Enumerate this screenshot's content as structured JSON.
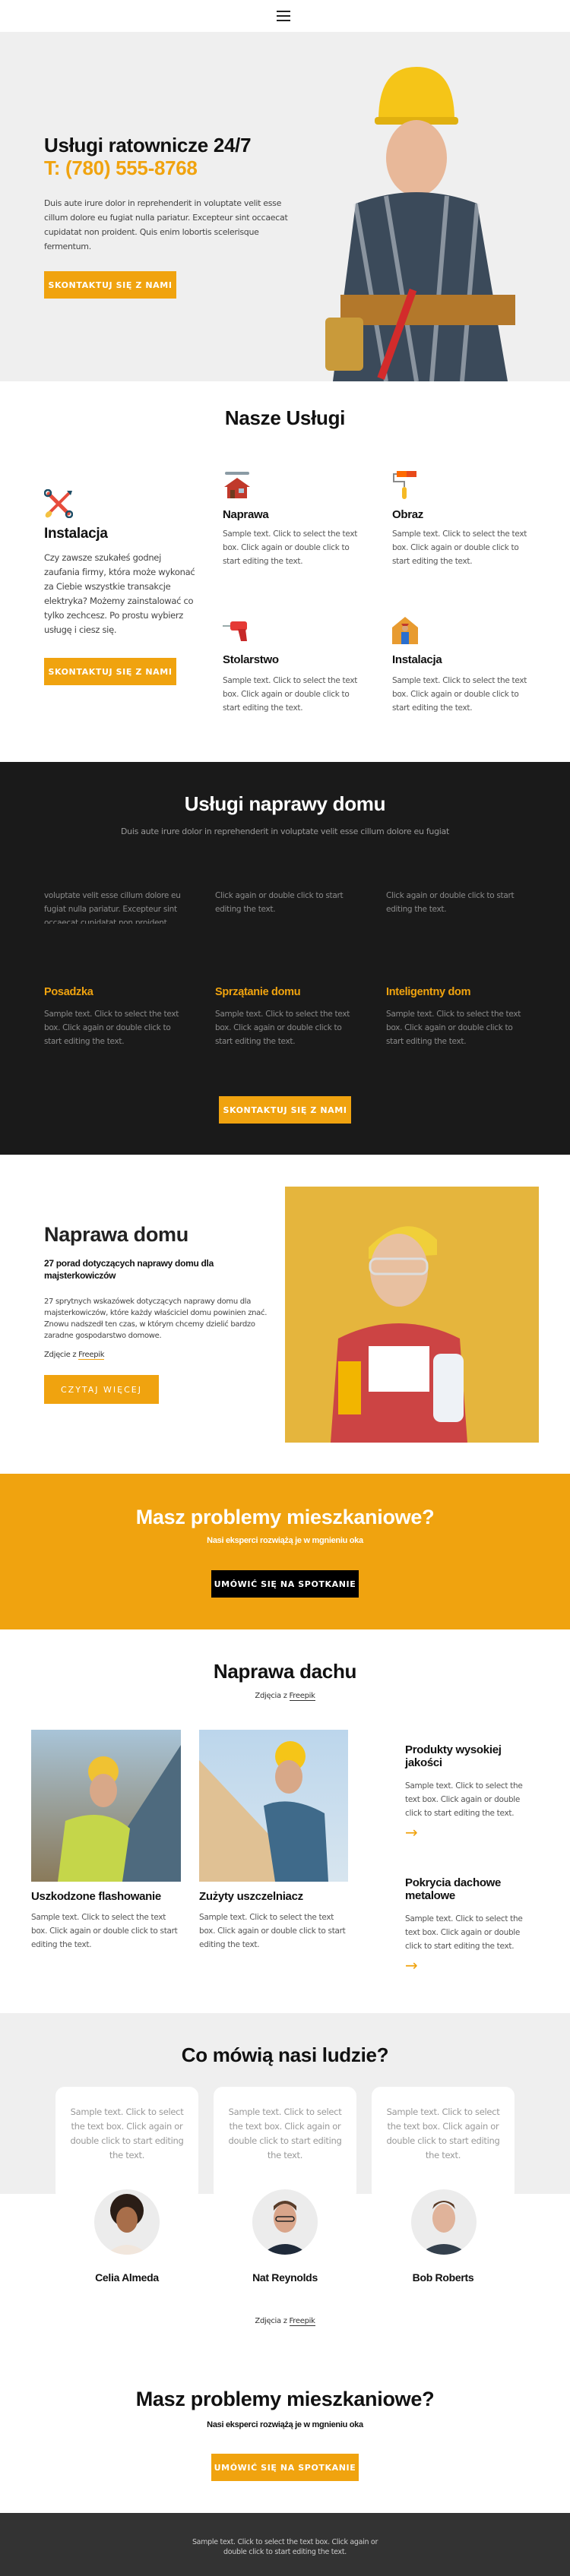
{
  "header": {
    "menu_icon": "hamburger-menu-icon"
  },
  "hero": {
    "title": "Usługi ratownicze 24/7",
    "phone": "T: (780) 555-8768",
    "text": "Duis aute irure dolor in reprehenderit in voluptate velit esse cillum dolore eu fugiat nulla pariatur. Excepteur sint occaecat cupidatat non proident. Quis enim lobortis scelerisque fermentum.",
    "button": "SKONTAKTUJ SIĘ Z NAMI",
    "image": "worker-with-hard-hat-photo"
  },
  "services": {
    "heading": "Nasze Usługi",
    "featured": {
      "icon": "tools-icon",
      "title": "Instalacja",
      "text": "Czy zawsze szukałeś godnej zaufania firmy, która może wykonać za Ciebie wszystkie transakcje elektryka? Możemy zainstalować co tylko zechcesz. Po prostu wybierz usługę i ciesz się.",
      "button": "SKONTAKTUJ SIĘ Z NAMI"
    },
    "items": [
      {
        "icon": "house-repair-icon",
        "title": "Naprawa",
        "text": "Sample text. Click to select the text box. Click again or double click to start editing the text."
      },
      {
        "icon": "paint-roller-icon",
        "title": "Obraz",
        "text": "Sample text. Click to select the text box. Click again or double click to start editing the text."
      },
      {
        "icon": "drill-icon",
        "title": "Stolarstwo",
        "text": "Sample text. Click to select the text box. Click again or double click to start editing the text."
      },
      {
        "icon": "house-worker-icon",
        "title": "Instalacja",
        "text": "Sample text. Click to select the text box. Click again or double click to start editing the text."
      }
    ]
  },
  "home_repair": {
    "heading": "Usługi naprawy domu",
    "subheading": "Duis aute irure dolor in reprehenderit in voluptate velit esse cillum dolore eu fugiat",
    "clipped_texts": [
      "voluptate velit esse cillum dolore eu fugiat nulla pariatur. Excepteur sint occaecat cupidatat non proident, sunt",
      "Click again or double click to start editing the text.",
      "Click again or double click to start editing the text."
    ],
    "items": [
      {
        "title": "Posadzka",
        "text": "Sample text. Click to select the text box. Click again or double click to start editing the text."
      },
      {
        "title": "Sprzątanie domu",
        "text": "Sample text. Click to select the text box. Click again or double click to start editing the text."
      },
      {
        "title": "Inteligentny dom",
        "text": "Sample text. Click to select the text box. Click again or double click to start editing the text."
      }
    ],
    "button": "SKONTAKTUJ SIĘ Z NAMI"
  },
  "article": {
    "heading": "Naprawa domu",
    "subheading": "27 porad dotyczących naprawy domu dla majsterkowiczów",
    "text": "27 sprytnych wskazówek dotyczących naprawy domu dla majsterkowiczów, które każdy właściciel domu powinien znać. Znowu nadszedł ten czas, w którym chcemy dzielić bardzo zaradne gospodarstwo domowe.",
    "credit_prefix": "Zdjęcie z ",
    "credit_link": "Freepik",
    "button": "CZYTAJ WIĘCEJ",
    "image": "woman-with-drill-photo"
  },
  "cta1": {
    "heading": "Masz problemy mieszkaniowe?",
    "subheading": "Nasi eksperci rozwiążą je w mgnieniu oka",
    "button": "UMÓWIĆ SIĘ NA SPOTKANIE"
  },
  "roof": {
    "heading": "Naprawa dachu",
    "credit_prefix": "Zdjęcia z ",
    "credit_link": "Freepik",
    "cards": [
      {
        "image": "roofer-with-drill-photo",
        "title": "Uszkodzone flashowanie",
        "text": "Sample text. Click to select the text box. Click again or double click to start editing the text."
      },
      {
        "image": "roofer-with-hammer-photo",
        "title": "Zużyty uszczelniacz",
        "text": "Sample text. Click to select the text box. Click again or double click to start editing the text."
      }
    ],
    "features": [
      {
        "title": "Produkty wysokiej jakości",
        "text": "Sample text. Click to select the text box. Click again or double click to start editing the text.",
        "arrow": "→"
      },
      {
        "title": "Pokrycia dachowe metalowe",
        "text": "Sample text. Click to select the text box. Click again or double click to start editing the text.",
        "arrow": "→"
      }
    ]
  },
  "testimonials": {
    "heading": "Co mówią nasi ludzie?",
    "items": [
      {
        "text": "Sample text. Click to select the text box. Click again or double click to start editing the text.",
        "name": "Celia Almeda"
      },
      {
        "text": "Sample text. Click to select the text box. Click again or double click to start editing the text.",
        "name": "Nat Reynolds"
      },
      {
        "text": "Sample text. Click to select the text box. Click again or double click to start editing the text.",
        "name": "Bob Roberts"
      }
    ],
    "credit_prefix": "Zdjęcia z ",
    "credit_link": "Freepik"
  },
  "cta2": {
    "heading": "Masz problemy mieszkaniowe?",
    "subheading": "Nasi eksperci rozwiążą je w mgnieniu oka",
    "button": "UMÓWIĆ SIĘ NA SPOTKANIE"
  },
  "footer": {
    "text": "Sample text. Click to select the text box. Click again or double click to start editing the text."
  },
  "colors": {
    "accent": "#f0a30f",
    "dark": "#1a1a1a",
    "light_bg": "#efefef",
    "footer": "#333333"
  }
}
